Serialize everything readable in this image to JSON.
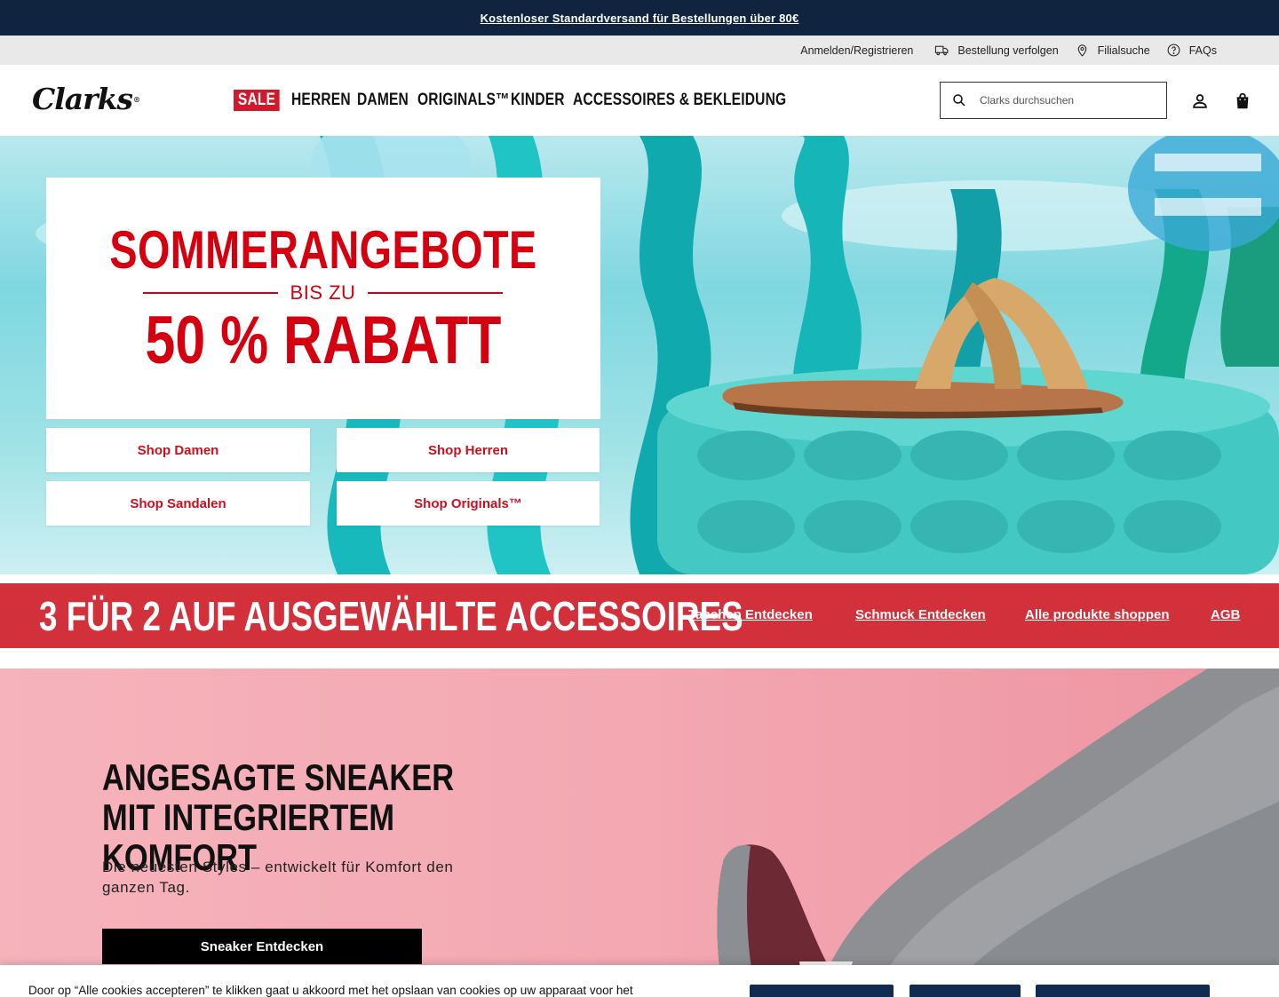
{
  "promo_bar": {
    "text": "Kostenloser Standardversand für Bestellungen über 80€"
  },
  "utility": {
    "login": "Anmelden/Registrieren",
    "track_order": "Bestellung verfolgen",
    "store_finder": "Filialsuche",
    "faqs": "FAQs"
  },
  "header": {
    "logo": "Clarks",
    "nav": [
      "SALE",
      "HERREN",
      "DAMEN",
      "ORIGINALS™",
      "KINDER",
      "ACCESSOIRES & BEKLEIDUNG"
    ],
    "search_placeholder": "Clarks durchsuchen"
  },
  "hero": {
    "title": "SOMMERANGEBOTE",
    "subtitle": "BIS ZU",
    "discount": "50 % RABATT",
    "buttons": [
      "Shop Damen",
      "Shop Herren",
      "Shop Sandalen",
      "Shop Originals™"
    ]
  },
  "promo_band": {
    "title": "3 FÜR 2 AUF AUSGEWÄHLTE ACCESSOIRES",
    "links": [
      "Taschen Entdecken",
      "Schmuck Entdecken",
      "Alle produkte shoppen",
      "AGB"
    ]
  },
  "sneaker": {
    "title": "ANGESAGTE SNEAKER MIT INTEGRIERTEM KOMFORT",
    "subtitle": "Die neuesten Styles – entwickelt für Komfort den ganzen Tag.",
    "button": "Sneaker Entdecken"
  },
  "cookie": {
    "text": "Door op “Alle cookies accepteren” te klikken gaat u akkoord met het opslaan van cookies op uw apparaat voor het"
  },
  "colors": {
    "navy": "#102440",
    "brand_red": "#d4000f",
    "promo_band_red": "#d2303a",
    "sneaker_pink": "#f3a8b2",
    "hero_aqua": "#7fd7e0"
  }
}
